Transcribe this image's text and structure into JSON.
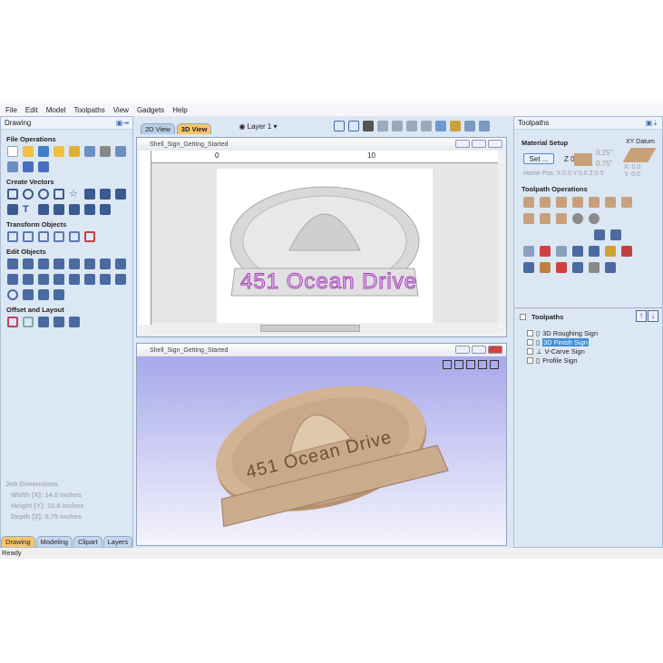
{
  "menu": [
    "File",
    "Edit",
    "Model",
    "Toolpaths",
    "View",
    "Gadgets",
    "Help"
  ],
  "left_panel": {
    "title": "Drawing",
    "sections": [
      "File Operations",
      "Create Vectors",
      "Transform Objects",
      "Edit Objects",
      "Offset and Layout"
    ],
    "job": {
      "title": "Job Dimensions",
      "width": "Width  [X]: 14.0 inches",
      "height": "Height [Y]: 10.0 inches",
      "depth": "Depth  [Z]: 0.75 inches"
    },
    "tabs": [
      "Drawing",
      "Modeling",
      "Clipart",
      "Layers"
    ]
  },
  "view_tabs": [
    "2D View",
    "3D View"
  ],
  "layer": "Layer 1 ▾",
  "doc_title": "Shell_Sign_Getting_Started",
  "ruler": [
    "0",
    "10"
  ],
  "sign_text": "451 Ocean Drive",
  "right_panel": {
    "title": "Toolpaths",
    "material_setup": "Material Setup",
    "set_button": "Set ...",
    "z0": "Z 0",
    "top_offset": "0.25\"",
    "thickness": "0.75\"",
    "home_pos": "Home Pos:  X:0.0 Y:0.0 Z:0.5",
    "xy_datum": "XY Datum",
    "datum_x": "X: 0.0",
    "datum_y": "Y: 0.0",
    "operations": "Toolpath Operations",
    "list_title": "Toolpaths",
    "toolpaths": [
      {
        "name": "3D Roughing Sign",
        "selected": false
      },
      {
        "name": "3D Finish Sign",
        "selected": true
      },
      {
        "name": "V-Carve Sign",
        "selected": false
      },
      {
        "name": "Profile Sign",
        "selected": false
      }
    ]
  },
  "status": "Ready",
  "colors": {
    "accent": "#3f8fd6",
    "sign_text": "#d25fe0",
    "wood": "#c9a98a",
    "bg3d": "#b8b8f0"
  }
}
